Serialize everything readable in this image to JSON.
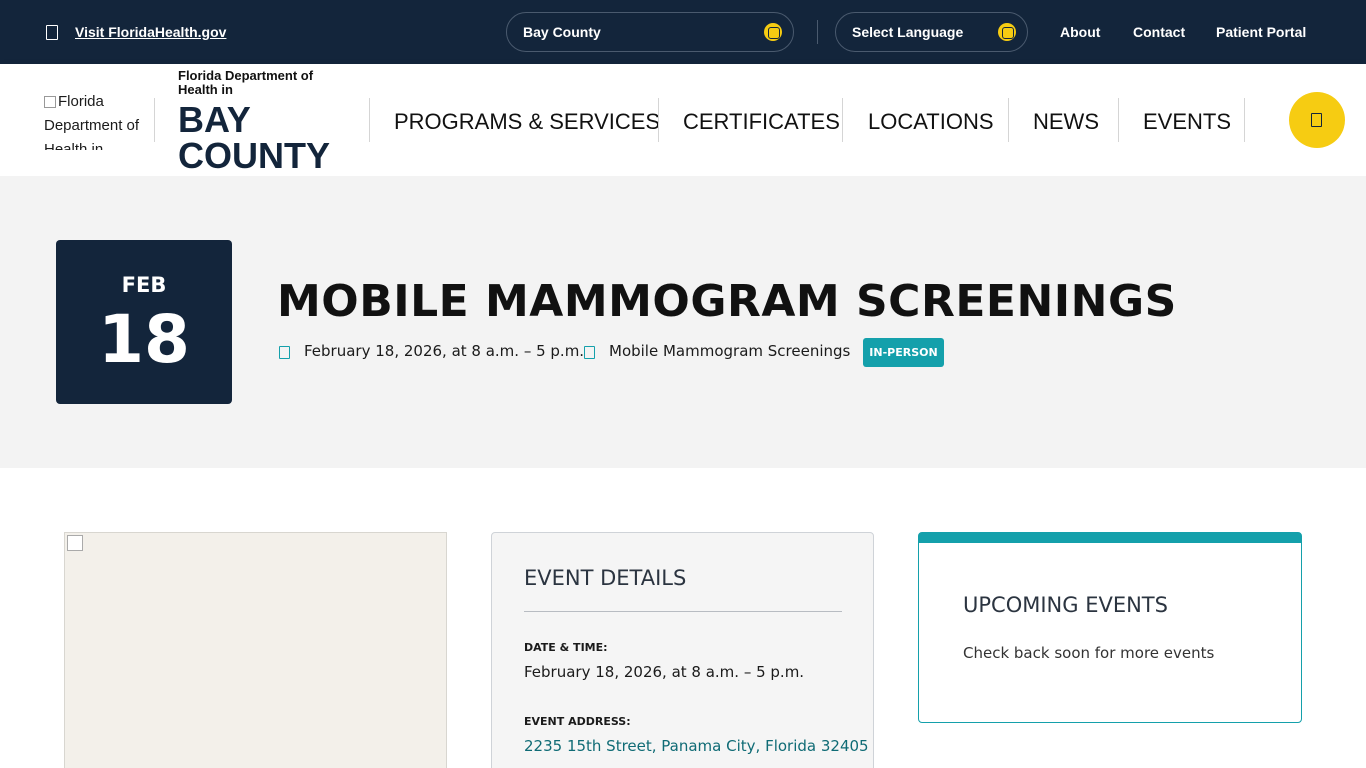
{
  "topbar": {
    "visit_link": "Visit FloridaHealth.gov",
    "county_select": "Bay County",
    "language_select": "Select Language",
    "links": [
      "About",
      "Contact",
      "Patient Portal"
    ]
  },
  "header": {
    "logo_alt": "Florida Department of Health in",
    "dept_line": "Florida Department of Health in",
    "county_line": "BAY COUNTY",
    "nav": [
      "PROGRAMS & SERVICES",
      "CERTIFICATES",
      "LOCATIONS",
      "NEWS",
      "EVENTS"
    ]
  },
  "event": {
    "month": "FEB",
    "day": "18",
    "title": "MOBILE MAMMOGRAM SCREENINGS",
    "datetime": "February 18, 2026, at 8 a.m. – 5 p.m.",
    "category": "Mobile Mammogram Screenings",
    "badge": "IN-PERSON"
  },
  "details": {
    "title": "EVENT DETAILS",
    "date_label": "DATE & TIME:",
    "date_value": "February 18, 2026, at 8 a.m. – 5 p.m.",
    "address_label": "EVENT ADDRESS:",
    "address_value": "2235 15th Street, Panama City, Florida 32405"
  },
  "upcoming": {
    "title": "UPCOMING EVENTS",
    "text": "Check back soon for more events"
  },
  "colors": {
    "navy": "#13253b",
    "accent_yellow": "#f6cc12",
    "teal": "#14a0ab",
    "hero_bg": "#f3f3f3"
  },
  "icons": [
    "document-icon",
    "globe-icon",
    "search-icon",
    "calendar-icon",
    "tag-icon"
  ]
}
